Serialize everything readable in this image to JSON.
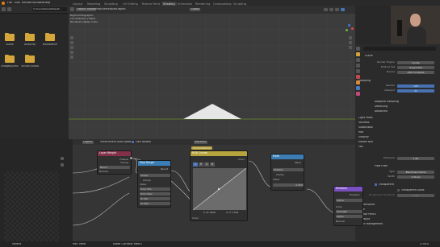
{
  "menu": [
    "File",
    "Edit",
    "Render",
    "Window",
    "Help"
  ],
  "workspaces": [
    "Layout",
    "Modeling",
    "Sculpting",
    "UV Editing",
    "Texture Paint",
    "Shading",
    "Animation",
    "Rendering",
    "Compositing",
    "Scripting"
  ],
  "active_workspace": "Shading",
  "file_browser": {
    "path": "C:\\Users\\Daniel\\Deskt...",
    "items": [
      "Audio",
      "Audacity",
      "Blockbench",
      "Images/Icons",
      "Virtual Studio",
      ""
    ]
  },
  "viewport": {
    "mode": "Object Mode",
    "menus": [
      "View",
      "Select",
      "Add",
      "Object"
    ],
    "shading": "Global",
    "info_lines": [
      "Right Orthographic",
      "(1) Collection | Plane",
      "Rendered (Apply Cuts)"
    ]
  },
  "node_editor": {
    "object_dropdown": "Object",
    "menus": [
      "View",
      "Select",
      "Add",
      "Node"
    ],
    "use_nodes": "Use Nodes",
    "material": "Material",
    "frame_label": "rtx:ColorRamp",
    "nodes": {
      "layer_weight": {
        "title": "Layer Weight",
        "outputs": [
          "Fresnel",
          "Facing"
        ],
        "blend_label": "Blend",
        "blend_value": "0.500",
        "normal": "Normal"
      },
      "map_range": {
        "title": "Map Range",
        "result": "Result",
        "type": "Linear",
        "clamp": "Clamp",
        "value": "Value",
        "rows": [
          [
            "From Min",
            "0.000"
          ],
          [
            "From Max",
            "1.000"
          ],
          [
            "To Min",
            "0.000"
          ],
          [
            "To Max",
            "1.000"
          ]
        ]
      },
      "rgb_curves": {
        "title": "RGB Curves",
        "color_out": "Color",
        "channels": [
          "C",
          "R",
          "G",
          "B"
        ],
        "factor": "Fac",
        "color_in": "Color",
        "bottom": [
          "0.32 2800",
          "0.77 2766"
        ]
      },
      "math": {
        "title": "Math",
        "value_out": "Value",
        "op": "Multiply",
        "clamp": "Clamp",
        "value": "Value",
        "value2": "0.950"
      },
      "principled": {
        "title": "Emission",
        "out": "Emission",
        "mode": "Alpha",
        "rows": [
          [
            "Color",
            ""
          ],
          [
            "Strength",
            "1.000"
          ],
          [
            "Alpha",
            "1.000"
          ],
          [
            "Normal",
            ""
          ]
        ]
      }
    }
  },
  "properties": {
    "scene": "Scene",
    "render_engine_label": "Render Engine",
    "render_engine": "Cycles",
    "feature_set_label": "Feature Set",
    "feature_set": "Supported",
    "device_label": "Device",
    "device": "GPU Compute",
    "sampling": "Sampling",
    "render_label": "Render",
    "render_samples": "128",
    "viewport_label": "Viewport",
    "viewport_samples": "32",
    "sections": [
      "Adaptive Sampling",
      "Denoising",
      "Advanced",
      "Light Paths",
      "Volumes",
      "Subdivision",
      "Hair",
      "Simplify",
      "Motion Blur",
      "Film"
    ],
    "exposure_label": "Exposure",
    "exposure": "1.00",
    "pixel_filter": "Pixel Filter",
    "type_label": "Type",
    "type": "Blackman-Harris",
    "width_label": "Width",
    "width": "1.50 px",
    "transparent": "Transparent",
    "transparent_glass": "Transparent Glass",
    "roughness_label": "Roughness Threshold",
    "roughness": "0.10",
    "bottom_sections": [
      "Performance",
      "Bake",
      "Grease Pencil",
      "Freestyle",
      "Color Management"
    ]
  },
  "status": {
    "left": "Select",
    "mid1": "Pan View",
    "mid2": "Node Context Menu",
    "version": "2.90.0"
  },
  "colors": {
    "accent": "#4772b3",
    "folder": "#d5a63a",
    "node_input": "#83314a",
    "node_converter": "#3b7eb5",
    "node_color": "#b8a43d",
    "node_shader": "#7a4fbf"
  }
}
